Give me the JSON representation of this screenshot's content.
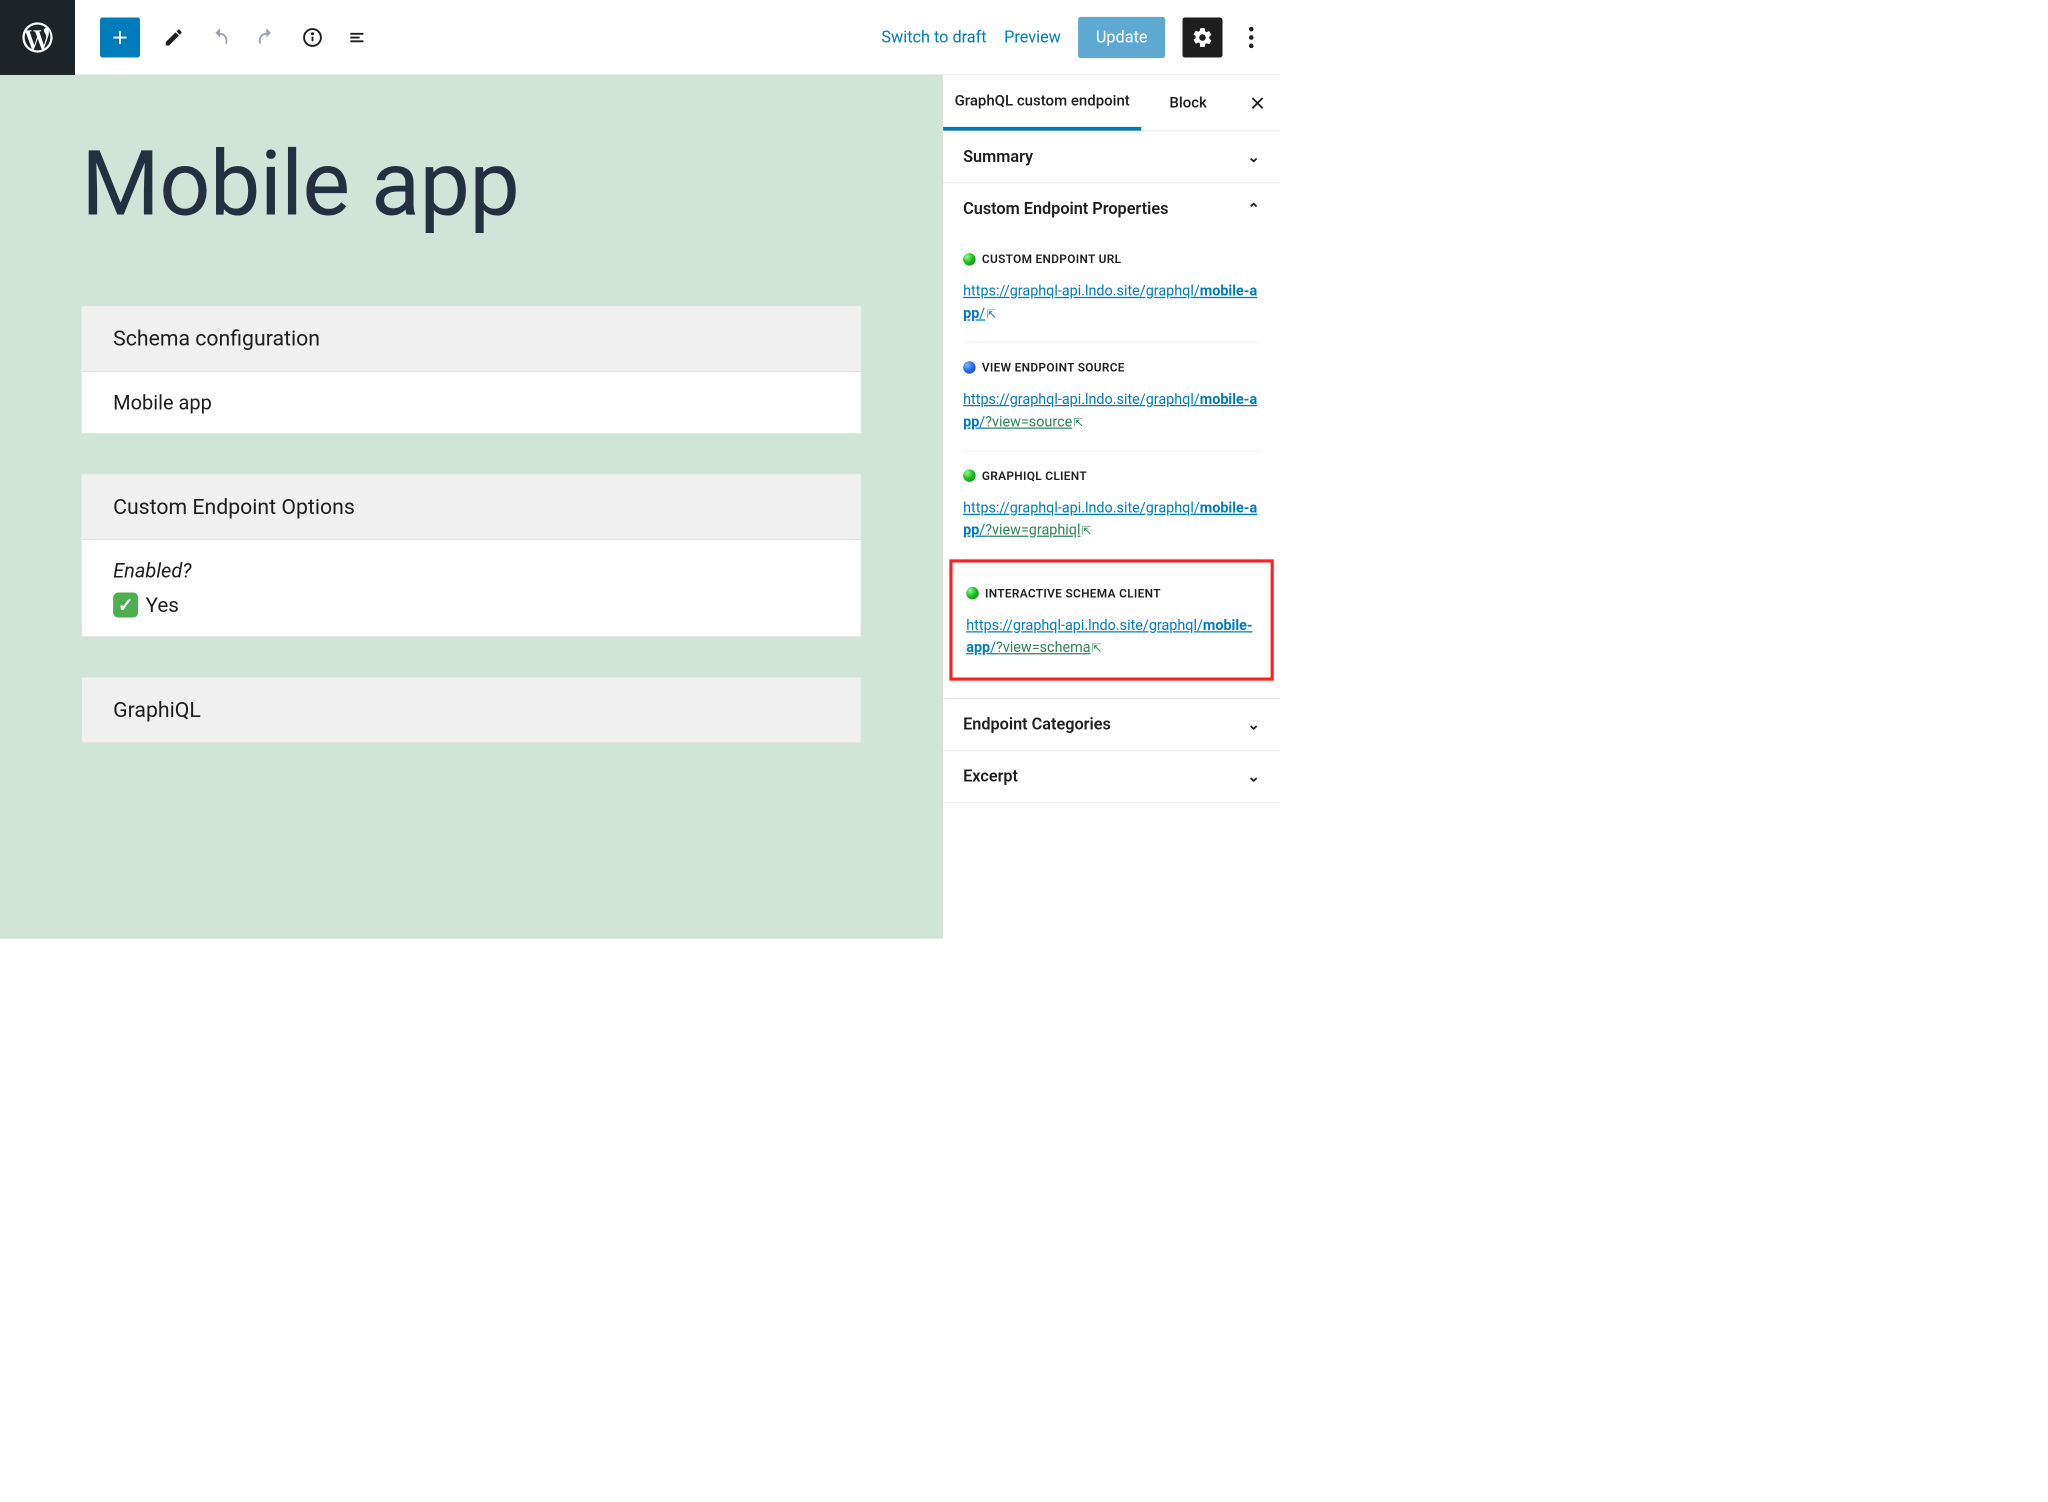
{
  "topbar": {
    "switch_draft": "Switch to draft",
    "preview": "Preview",
    "update": "Update"
  },
  "editor": {
    "title": "Mobile app",
    "blocks": {
      "schema_config": {
        "header": "Schema configuration",
        "value": "Mobile app"
      },
      "endpoint_options": {
        "header": "Custom Endpoint Options",
        "enabled_label": "Enabled?",
        "enabled_value": "Yes"
      },
      "graphiql": {
        "header": "GraphiQL"
      }
    }
  },
  "sidebar": {
    "tabs": {
      "custom": "GraphQL custom endpoint",
      "block": "Block"
    },
    "sections": {
      "summary": "Summary",
      "custom_props": "Custom Endpoint Properties",
      "categories": "Endpoint Categories",
      "excerpt": "Excerpt"
    },
    "props": {
      "url_label": "CUSTOM ENDPOINT URL",
      "url_base": "https://graphql-api.lndo.site/graphql/",
      "url_slug": "mobile-app",
      "url_trail": "/",
      "source_label": "VIEW ENDPOINT SOURCE",
      "source_q": "?view=source",
      "graphiql_label": "GRAPHIQL CLIENT",
      "graphiql_q": "?view=graphiql",
      "schema_label": "INTERACTIVE SCHEMA CLIENT",
      "schema_q": "?view=schema"
    }
  }
}
